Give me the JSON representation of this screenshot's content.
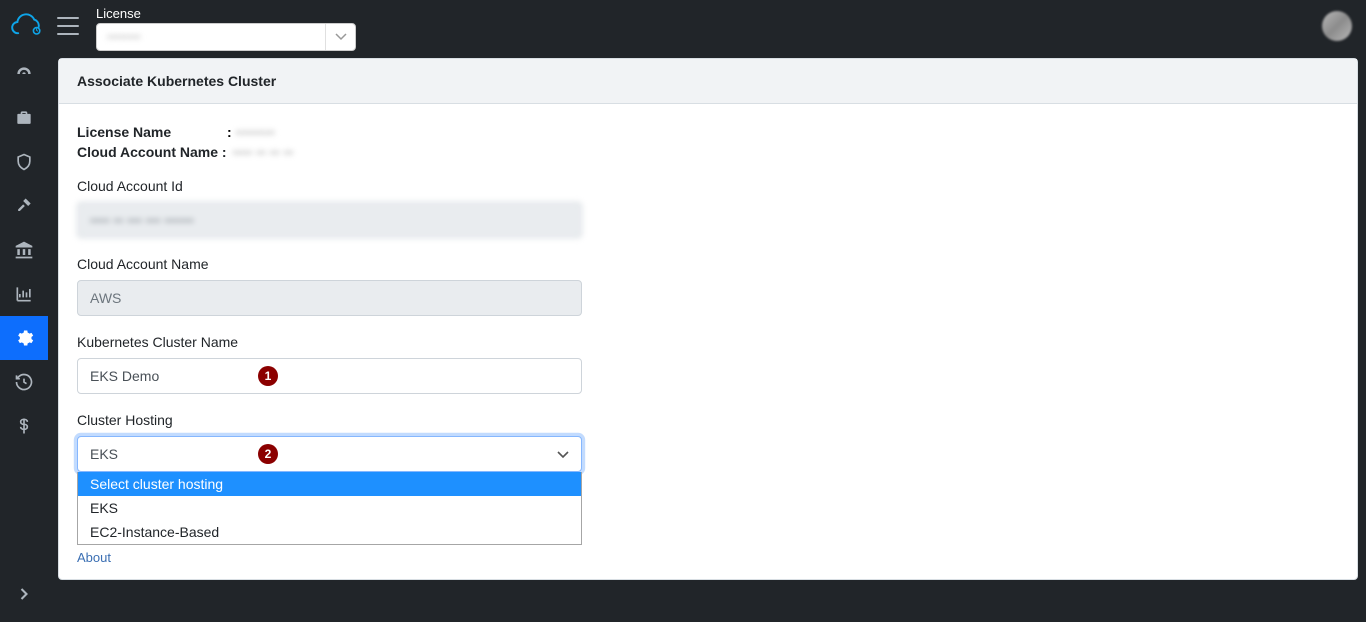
{
  "header": {
    "license_label": "License",
    "license_value": "••••••••"
  },
  "sidebar": {
    "items": [
      {
        "name": "dashboard"
      },
      {
        "name": "briefcase"
      },
      {
        "name": "shield"
      },
      {
        "name": "gavel"
      },
      {
        "name": "institution"
      },
      {
        "name": "chart"
      },
      {
        "name": "settings",
        "active": true
      },
      {
        "name": "history"
      },
      {
        "name": "dollar"
      }
    ]
  },
  "panel": {
    "title": "Associate Kubernetes Cluster",
    "license_name_key": "License Name",
    "license_name_value": "••••••••",
    "cloud_account_key": "Cloud Account Name :",
    "cloud_account_value": "•••• •• •• ••"
  },
  "form": {
    "cloud_account_id_label": "Cloud Account Id",
    "cloud_account_id_value": "•••• •• ••• ••• ••••••",
    "cloud_account_name_label": "Cloud Account Name",
    "cloud_account_name_value": "AWS",
    "k8s_name_label": "Kubernetes Cluster Name",
    "k8s_name_value": "EKS Demo",
    "hosting_label": "Cluster Hosting",
    "hosting_selected": "EKS",
    "hosting_options": {
      "placeholder": "Select cluster hosting",
      "opt1": "EKS",
      "opt2": "EC2-Instance-Based"
    }
  },
  "callouts": {
    "c1": "1",
    "c2": "2"
  },
  "footer": {
    "about": "About"
  }
}
